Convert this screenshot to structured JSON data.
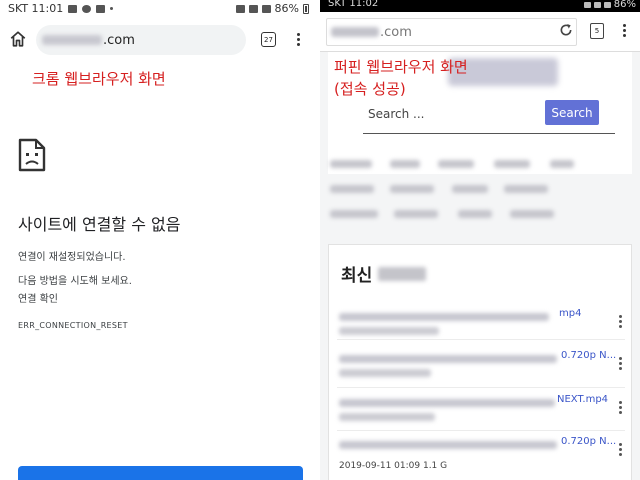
{
  "left": {
    "status": {
      "time": "SKT 11:01",
      "battery": "86%"
    },
    "toolbar": {
      "url_domain": ".com",
      "tab_count": "27"
    },
    "note": "크롬 웹브라우저 화면",
    "error": {
      "title": "사이트에 연결할 수 없음",
      "line1": "연결이 재설정되었습니다.",
      "line2": "다음 방법을 시도해 보세요.",
      "line3": "연결 확인",
      "code": "ERR_CONNECTION_RESET"
    }
  },
  "right": {
    "status": {
      "time": "SKT 11:02",
      "battery": "86%"
    },
    "toolbar": {
      "url_domain": ".com",
      "tab_count": "5"
    },
    "note_line1": "퍼핀 웹브라우저 화면",
    "note_line2": "(접속 성공)",
    "search": {
      "placeholder": "Search ...",
      "button": "Search"
    },
    "card": {
      "title": "최신",
      "items": [
        {
          "ext": "mp4",
          "meta": ""
        },
        {
          "ext": "0.720p N...",
          "meta": ""
        },
        {
          "ext": "NEXT.mp4",
          "meta": ""
        },
        {
          "ext": "0.720p N...",
          "meta": "2019-09-11 01:09   1.1 G"
        }
      ]
    }
  }
}
